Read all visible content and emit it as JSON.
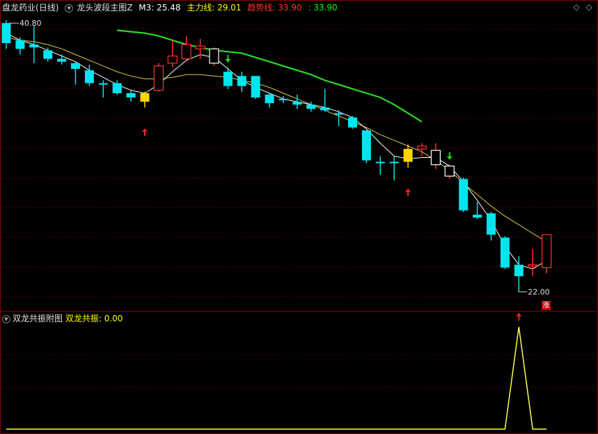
{
  "header": {
    "title": "盘龙药业",
    "period": "(日线)",
    "indicator_name": "龙头波段主图Z",
    "m3_label": "M3:",
    "m3_value": "25.48",
    "main_label": "主力线:",
    "main_value": "29.01",
    "trend_label": "趋势线:",
    "trend_value": "33.90",
    "extra_value": "33.90"
  },
  "sub_header": {
    "indicator_name": "双龙共振附图",
    "label": "双龙共振:",
    "value": "0.00"
  },
  "annotations": {
    "high_label": "40.80",
    "low_label": "22.00",
    "zhang_badge": "涨"
  },
  "icons": {
    "prev": "diamond-left-icon",
    "next": "diamond-right-icon"
  },
  "colors": {
    "background": "#000000",
    "grid": "#8b0000",
    "up": "#ff3030",
    "down": "#00e5ee",
    "doji_yellow": "#ffd700",
    "white_box": "#ffffff",
    "trend_line": "#22dd22",
    "main_line": "#ddcc44",
    "m3_line": "#ffffff",
    "sub_line": "#ffff44",
    "m3_text": "#ffffff",
    "main_text": "#ffff00",
    "trend_text": "#ff3030",
    "extra_text": "#00ff00"
  },
  "chart_data": [
    {
      "type": "candlestick",
      "price_range": [
        21.5,
        41.2
      ],
      "candles": [
        {
          "o": 40.8,
          "c": 39.4,
          "h": 41.0,
          "l": 39.0,
          "s": "down"
        },
        {
          "o": 39.6,
          "c": 39.0,
          "h": 39.8,
          "l": 38.6,
          "s": "down"
        },
        {
          "o": 39.3,
          "c": 39.1,
          "h": 40.6,
          "l": 38.0,
          "s": "down"
        },
        {
          "o": 38.9,
          "c": 38.3,
          "h": 39.1,
          "l": 38.1,
          "s": "down"
        },
        {
          "o": 38.3,
          "c": 38.1,
          "h": 38.6,
          "l": 37.9,
          "s": "down"
        },
        {
          "o": 38.0,
          "c": 37.6,
          "h": 38.1,
          "l": 36.5,
          "s": "down"
        },
        {
          "o": 37.5,
          "c": 36.6,
          "h": 37.9,
          "l": 36.4,
          "s": "down"
        },
        {
          "o": 36.6,
          "c": 36.5,
          "h": 36.8,
          "l": 35.6,
          "s": "down"
        },
        {
          "o": 36.6,
          "c": 35.9,
          "h": 36.8,
          "l": 35.8,
          "s": "down"
        },
        {
          "o": 35.9,
          "c": 35.6,
          "h": 36.1,
          "l": 35.3,
          "s": "down"
        },
        {
          "o": 35.3,
          "c": 35.9,
          "h": 36.0,
          "l": 34.9,
          "s": "doji"
        },
        {
          "o": 36.1,
          "c": 37.8,
          "h": 38.0,
          "l": 36.0,
          "s": "up"
        },
        {
          "o": 38.0,
          "c": 38.5,
          "h": 39.6,
          "l": 37.7,
          "s": "up"
        },
        {
          "o": 38.3,
          "c": 39.3,
          "h": 39.9,
          "l": 38.2,
          "s": "up"
        },
        {
          "o": 39.2,
          "c": 39.0,
          "h": 39.7,
          "l": 38.3,
          "s": "up"
        },
        {
          "o": 39.0,
          "c": 38.0,
          "h": 39.1,
          "l": 37.8,
          "s": "white"
        },
        {
          "o": 37.4,
          "c": 36.4,
          "h": 37.7,
          "l": 36.2,
          "s": "down"
        },
        {
          "o": 37.1,
          "c": 36.4,
          "h": 37.4,
          "l": 36.0,
          "s": "down"
        },
        {
          "o": 37.1,
          "c": 35.6,
          "h": 37.1,
          "l": 35.5,
          "s": "down"
        },
        {
          "o": 35.8,
          "c": 35.2,
          "h": 35.9,
          "l": 34.9,
          "s": "down"
        },
        {
          "o": 35.5,
          "c": 35.4,
          "h": 35.7,
          "l": 35.2,
          "s": "down"
        },
        {
          "o": 35.3,
          "c": 35.1,
          "h": 35.8,
          "l": 34.8,
          "s": "down"
        },
        {
          "o": 35.1,
          "c": 34.8,
          "h": 35.3,
          "l": 34.6,
          "s": "down"
        },
        {
          "o": 34.9,
          "c": 34.7,
          "h": 36.2,
          "l": 34.6,
          "s": "down"
        },
        {
          "o": 34.5,
          "c": 34.4,
          "h": 34.7,
          "l": 33.6,
          "s": "down"
        },
        {
          "o": 34.2,
          "c": 33.5,
          "h": 34.3,
          "l": 33.4,
          "s": "down"
        },
        {
          "o": 33.3,
          "c": 31.2,
          "h": 33.3,
          "l": 31.0,
          "s": "down"
        },
        {
          "o": 31.1,
          "c": 31.0,
          "h": 31.5,
          "l": 30.2,
          "s": "down"
        },
        {
          "o": 31.1,
          "c": 31.0,
          "h": 31.5,
          "l": 29.8,
          "s": "down"
        },
        {
          "o": 31.1,
          "c": 32.0,
          "h": 32.3,
          "l": 30.7,
          "s": "doji"
        },
        {
          "o": 32.2,
          "c": 32.0,
          "h": 32.4,
          "l": 31.5,
          "s": "up"
        },
        {
          "o": 31.9,
          "c": 30.9,
          "h": 32.4,
          "l": 30.6,
          "s": "white"
        },
        {
          "o": 30.8,
          "c": 30.1,
          "h": 30.9,
          "l": 29.9,
          "s": "white"
        },
        {
          "o": 29.9,
          "c": 27.7,
          "h": 30.0,
          "l": 27.6,
          "s": "down"
        },
        {
          "o": 27.4,
          "c": 27.2,
          "h": 28.3,
          "l": 27.1,
          "s": "down"
        },
        {
          "o": 27.5,
          "c": 26.0,
          "h": 27.6,
          "l": 25.6,
          "s": "down"
        },
        {
          "o": 25.8,
          "c": 23.7,
          "h": 25.9,
          "l": 23.6,
          "s": "down"
        },
        {
          "o": 23.9,
          "c": 23.1,
          "h": 24.5,
          "l": 22.0,
          "s": "down"
        },
        {
          "o": 23.9,
          "c": 23.9,
          "h": 25.0,
          "l": 23.1,
          "s": "up"
        },
        {
          "o": 23.7,
          "c": 26.0,
          "h": 26.0,
          "l": 23.3,
          "s": "up"
        }
      ],
      "lines": {
        "trend": [
          [
            8,
            40.3
          ],
          [
            9,
            40.2
          ],
          [
            10,
            40.1
          ],
          [
            11,
            39.9
          ],
          [
            12,
            39.6
          ],
          [
            13,
            39.3
          ],
          [
            14,
            39.1
          ],
          [
            15,
            38.9
          ],
          [
            16,
            38.8
          ],
          [
            17,
            38.7
          ],
          [
            18,
            38.4
          ],
          [
            19,
            38.1
          ],
          [
            20,
            37.8
          ],
          [
            21,
            37.5
          ],
          [
            22,
            37.2
          ],
          [
            23,
            36.8
          ],
          [
            24,
            36.5
          ],
          [
            25,
            36.2
          ],
          [
            26,
            35.9
          ],
          [
            27,
            35.6
          ],
          [
            28,
            35.1
          ],
          [
            29,
            34.5
          ],
          [
            30,
            33.9
          ]
        ],
        "main": [
          [
            0,
            39.8
          ],
          [
            1,
            39.6
          ],
          [
            2,
            39.5
          ],
          [
            3,
            39.3
          ],
          [
            4,
            39.0
          ],
          [
            5,
            38.6
          ],
          [
            6,
            38.2
          ],
          [
            7,
            37.8
          ],
          [
            8,
            37.4
          ],
          [
            9,
            37.1
          ],
          [
            10,
            36.9
          ],
          [
            11,
            36.9
          ],
          [
            12,
            37.0
          ],
          [
            13,
            37.2
          ],
          [
            14,
            37.2
          ],
          [
            15,
            37.1
          ],
          [
            16,
            37.0
          ],
          [
            17,
            36.8
          ],
          [
            18,
            36.6
          ],
          [
            19,
            36.3
          ],
          [
            20,
            35.9
          ],
          [
            21,
            35.5
          ],
          [
            22,
            35.1
          ],
          [
            23,
            34.7
          ],
          [
            24,
            34.3
          ],
          [
            25,
            33.9
          ],
          [
            26,
            33.5
          ],
          [
            27,
            33.0
          ],
          [
            28,
            32.6
          ],
          [
            29,
            32.2
          ],
          [
            30,
            31.8
          ],
          [
            31,
            31.2
          ],
          [
            32,
            30.5
          ],
          [
            33,
            29.6
          ],
          [
            34,
            28.8
          ],
          [
            35,
            28.0
          ],
          [
            36,
            27.3
          ],
          [
            37,
            26.7
          ],
          [
            38,
            26.1
          ],
          [
            39,
            25.5
          ]
        ],
        "m3": [
          [
            0,
            40.1
          ],
          [
            1,
            39.6
          ],
          [
            2,
            39.3
          ],
          [
            3,
            38.9
          ],
          [
            4,
            38.5
          ],
          [
            5,
            38.1
          ],
          [
            6,
            37.5
          ],
          [
            7,
            37.0
          ],
          [
            8,
            36.5
          ],
          [
            9,
            36.1
          ],
          [
            10,
            35.9
          ],
          [
            11,
            36.5
          ],
          [
            12,
            37.4
          ],
          [
            13,
            38.2
          ],
          [
            14,
            38.6
          ],
          [
            15,
            38.4
          ],
          [
            16,
            37.6
          ],
          [
            17,
            36.8
          ],
          [
            18,
            36.3
          ],
          [
            19,
            35.9
          ],
          [
            20,
            35.5
          ],
          [
            21,
            35.3
          ],
          [
            22,
            35.1
          ],
          [
            23,
            34.9
          ],
          [
            24,
            34.6
          ],
          [
            25,
            34.2
          ],
          [
            26,
            33.4
          ],
          [
            27,
            32.4
          ],
          [
            28,
            31.5
          ],
          [
            29,
            31.3
          ],
          [
            30,
            31.4
          ],
          [
            31,
            31.4
          ],
          [
            32,
            30.8
          ],
          [
            33,
            29.7
          ],
          [
            34,
            28.4
          ],
          [
            35,
            27.0
          ],
          [
            36,
            25.2
          ],
          [
            37,
            23.9
          ],
          [
            38,
            23.6
          ],
          [
            39,
            24.2
          ]
        ]
      },
      "buy_arrows": [
        10,
        29,
        37
      ],
      "sell_arrows": [
        16,
        32
      ]
    },
    {
      "type": "line",
      "name": "双龙共振",
      "x": [
        0,
        36,
        37,
        38,
        39
      ],
      "values": [
        0,
        0,
        1,
        0,
        0
      ],
      "ylim": [
        0,
        1
      ]
    }
  ]
}
